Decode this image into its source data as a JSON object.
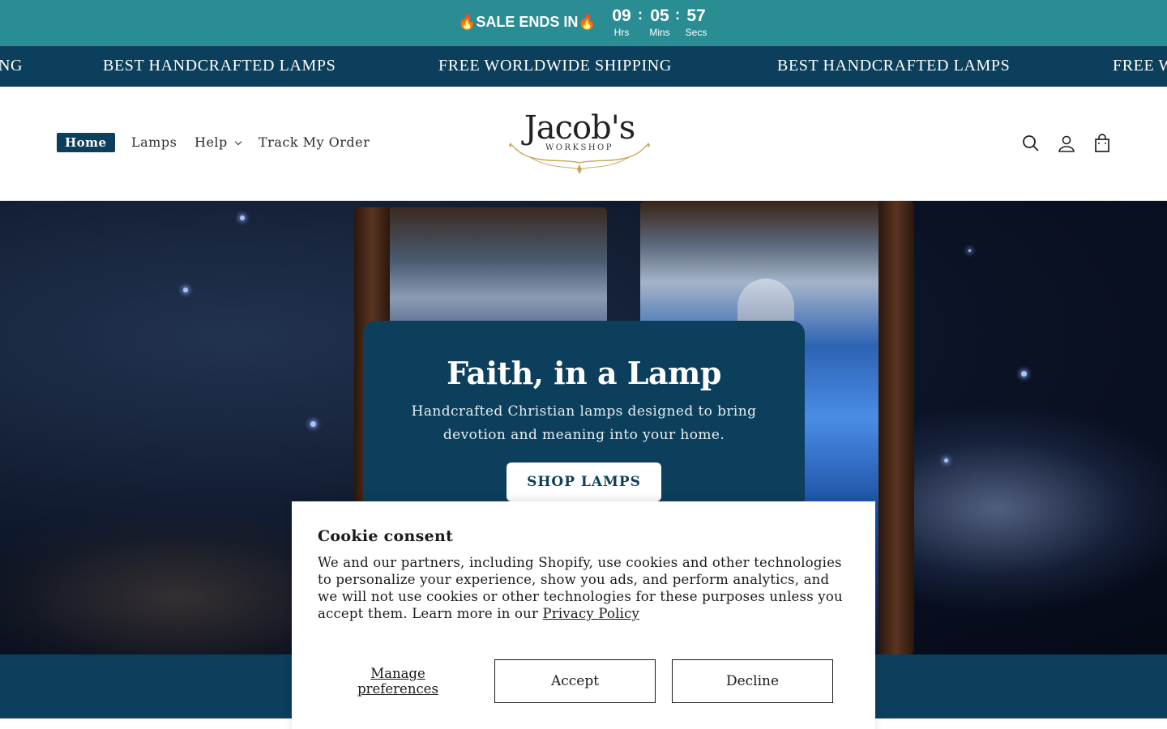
{
  "countdown": {
    "label": "🔥SALE ENDS IN🔥",
    "hours": "09",
    "hours_label": "Hrs",
    "minutes": "05",
    "minutes_label": "Mins",
    "seconds": "57",
    "seconds_label": "Secs",
    "separator": ":",
    "background": "#2a8d94"
  },
  "marquee": {
    "items": [
      "NG",
      "BEST HANDCRAFTED LAMPS",
      "FREE WORLDWIDE SHIPPING",
      "BEST HANDCRAFTED LAMPS",
      "FREE W"
    ],
    "background": "#0c3f5c"
  },
  "nav": {
    "items": [
      {
        "label": "Home",
        "active": true
      },
      {
        "label": "Lamps"
      },
      {
        "label": "Help",
        "has_dropdown": true
      },
      {
        "label": "Track My Order"
      }
    ]
  },
  "logo": {
    "name": "Jacob's",
    "subtitle": "WORKSHOP"
  },
  "header_icons": [
    "search-icon",
    "account-icon",
    "cart-icon"
  ],
  "hero": {
    "title": "Faith, in a Lamp",
    "subtitle": "Handcrafted Christian lamps designed to bring devotion and meaning into your home.",
    "cta_label": "SHOP LAMPS",
    "card_color": "#0c3f5c"
  },
  "cookie": {
    "title": "Cookie consent",
    "body": "We and our partners, including Shopify, use cookies and other technologies to personalize your experience, show you ads, and perform analytics, and we will not use cookies or other technologies for these purposes unless you accept them. Learn more in our ",
    "link_label": "Privacy Policy",
    "manage_label": "Manage preferences",
    "accept_label": "Accept",
    "decline_label": "Decline"
  }
}
